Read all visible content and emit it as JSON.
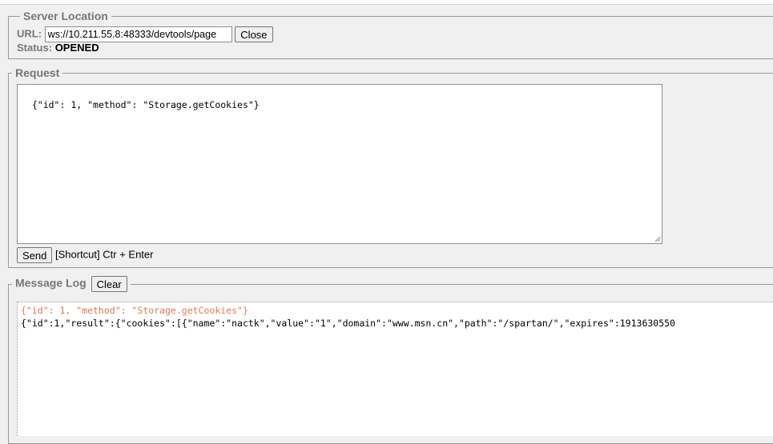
{
  "server_location": {
    "legend": "Server Location",
    "url_label": "URL:",
    "url_value": "ws://10.211.55.8:48333/devtools/page",
    "close_label": "Close",
    "status_label": "Status:",
    "status_value": "OPENED"
  },
  "request": {
    "legend": "Request",
    "body": "{\"id\": 1, \"method\": \"Storage.getCookies\"}",
    "send_label": "Send",
    "shortcut_text": "[Shortcut] Ctr + Enter"
  },
  "message_log": {
    "legend": "Message Log",
    "clear_label": "Clear",
    "entries": [
      {
        "text": "{\"id\": 1, \"method\": \"Storage.getCookies\"}",
        "color": "#e07b53"
      },
      {
        "text": "{\"id\":1,\"result\":{\"cookies\":[{\"name\":\"nactk\",\"value\":\"1\",\"domain\":\"www.msn.cn\",\"path\":\"/spartan/\",\"expires\":1913630550",
        "color": "#000000"
      }
    ]
  }
}
